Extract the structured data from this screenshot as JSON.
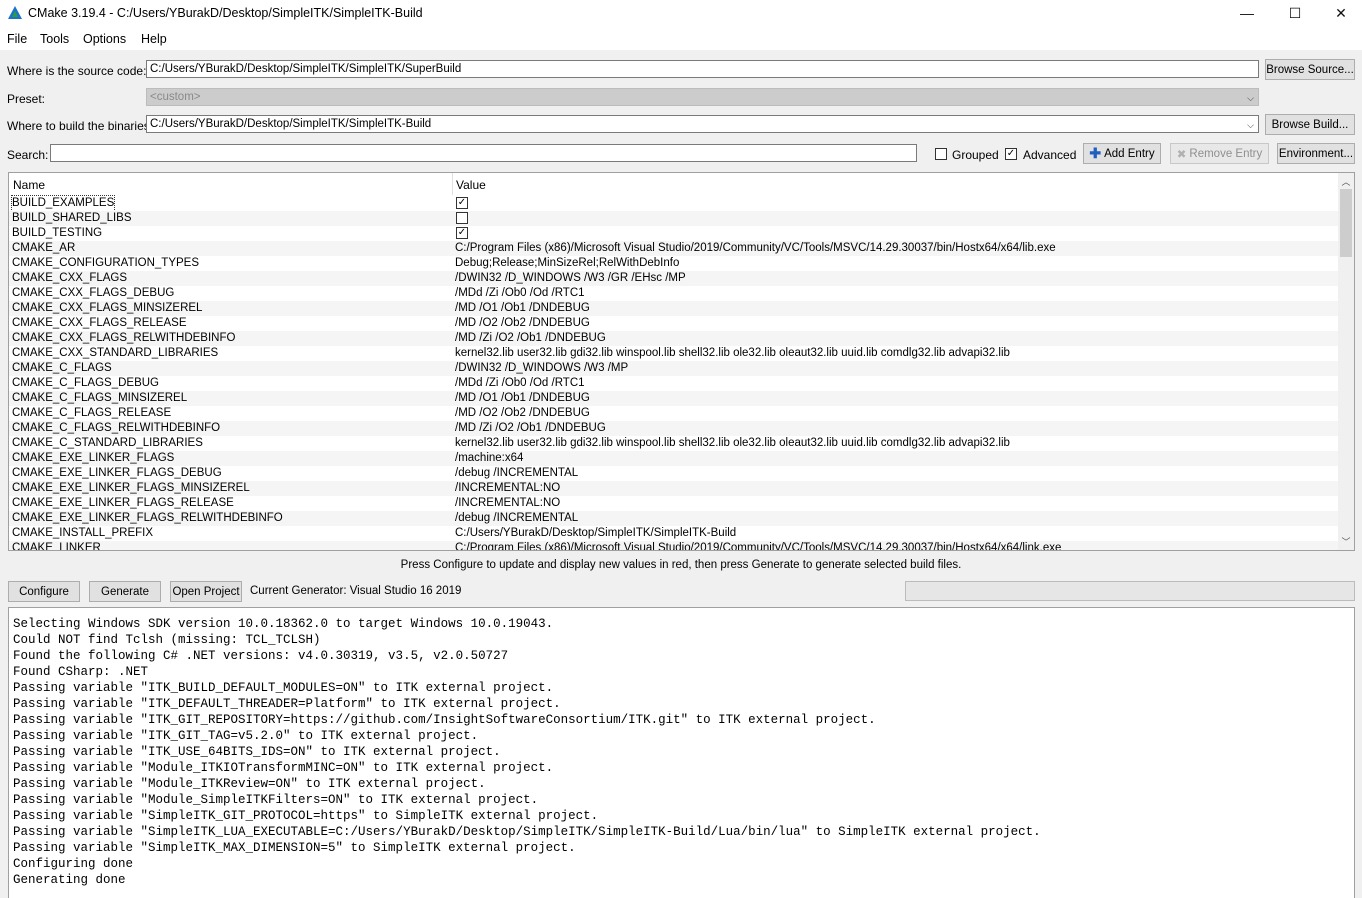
{
  "window": {
    "title": "CMake 3.19.4 - C:/Users/YBurakD/Desktop/SimpleITK/SimpleITK-Build",
    "minimize_glyph": "—",
    "maximize_glyph": "☐",
    "close_glyph": "✕"
  },
  "menu": [
    "File",
    "Tools",
    "Options",
    "Help"
  ],
  "source": {
    "label": "Where is the source code:",
    "value": "C:/Users/YBurakD/Desktop/SimpleITK/SimpleITK/SuperBuild",
    "browse_label": "Browse Source..."
  },
  "preset": {
    "label": "Preset:",
    "value": "<custom>"
  },
  "build": {
    "label": "Where to build the binaries:",
    "value": "C:/Users/YBurakD/Desktop/SimpleITK/SimpleITK-Build",
    "browse_label": "Browse Build..."
  },
  "search": {
    "label": "Search:",
    "value": "",
    "grouped_label": "Grouped",
    "grouped_checked": false,
    "advanced_label": "Advanced",
    "advanced_checked": true,
    "add_entry_label": "Add Entry",
    "remove_entry_label": "Remove Entry",
    "environment_label": "Environment..."
  },
  "table": {
    "columns": [
      "Name",
      "Value"
    ],
    "rows": [
      {
        "name": "BUILD_EXAMPLES",
        "type": "bool",
        "checked": true,
        "value": ""
      },
      {
        "name": "BUILD_SHARED_LIBS",
        "type": "bool",
        "checked": false,
        "value": ""
      },
      {
        "name": "BUILD_TESTING",
        "type": "bool",
        "checked": true,
        "value": ""
      },
      {
        "name": "CMAKE_AR",
        "type": "text",
        "value": "C:/Program Files (x86)/Microsoft Visual Studio/2019/Community/VC/Tools/MSVC/14.29.30037/bin/Hostx64/x64/lib.exe"
      },
      {
        "name": "CMAKE_CONFIGURATION_TYPES",
        "type": "text",
        "value": "Debug;Release;MinSizeRel;RelWithDebInfo"
      },
      {
        "name": "CMAKE_CXX_FLAGS",
        "type": "text",
        "value": "/DWIN32 /D_WINDOWS /W3 /GR /EHsc /MP"
      },
      {
        "name": "CMAKE_CXX_FLAGS_DEBUG",
        "type": "text",
        "value": "/MDd /Zi /Ob0 /Od /RTC1"
      },
      {
        "name": "CMAKE_CXX_FLAGS_MINSIZEREL",
        "type": "text",
        "value": "/MD /O1 /Ob1 /DNDEBUG"
      },
      {
        "name": "CMAKE_CXX_FLAGS_RELEASE",
        "type": "text",
        "value": "/MD /O2 /Ob2 /DNDEBUG"
      },
      {
        "name": "CMAKE_CXX_FLAGS_RELWITHDEBINFO",
        "type": "text",
        "value": "/MD /Zi /O2 /Ob1 /DNDEBUG"
      },
      {
        "name": "CMAKE_CXX_STANDARD_LIBRARIES",
        "type": "text",
        "value": "kernel32.lib user32.lib gdi32.lib winspool.lib shell32.lib ole32.lib oleaut32.lib uuid.lib comdlg32.lib advapi32.lib"
      },
      {
        "name": "CMAKE_C_FLAGS",
        "type": "text",
        "value": "/DWIN32 /D_WINDOWS /W3 /MP"
      },
      {
        "name": "CMAKE_C_FLAGS_DEBUG",
        "type": "text",
        "value": "/MDd /Zi /Ob0 /Od /RTC1"
      },
      {
        "name": "CMAKE_C_FLAGS_MINSIZEREL",
        "type": "text",
        "value": "/MD /O1 /Ob1 /DNDEBUG"
      },
      {
        "name": "CMAKE_C_FLAGS_RELEASE",
        "type": "text",
        "value": "/MD /O2 /Ob2 /DNDEBUG"
      },
      {
        "name": "CMAKE_C_FLAGS_RELWITHDEBINFO",
        "type": "text",
        "value": "/MD /Zi /O2 /Ob1 /DNDEBUG"
      },
      {
        "name": "CMAKE_C_STANDARD_LIBRARIES",
        "type": "text",
        "value": "kernel32.lib user32.lib gdi32.lib winspool.lib shell32.lib ole32.lib oleaut32.lib uuid.lib comdlg32.lib advapi32.lib"
      },
      {
        "name": "CMAKE_EXE_LINKER_FLAGS",
        "type": "text",
        "value": "/machine:x64"
      },
      {
        "name": "CMAKE_EXE_LINKER_FLAGS_DEBUG",
        "type": "text",
        "value": "/debug /INCREMENTAL"
      },
      {
        "name": "CMAKE_EXE_LINKER_FLAGS_MINSIZEREL",
        "type": "text",
        "value": "/INCREMENTAL:NO"
      },
      {
        "name": "CMAKE_EXE_LINKER_FLAGS_RELEASE",
        "type": "text",
        "value": "/INCREMENTAL:NO"
      },
      {
        "name": "CMAKE_EXE_LINKER_FLAGS_RELWITHDEBINFO",
        "type": "text",
        "value": "/debug /INCREMENTAL"
      },
      {
        "name": "CMAKE_INSTALL_PREFIX",
        "type": "text",
        "value": "C:/Users/YBurakD/Desktop/SimpleITK/SimpleITK-Build"
      },
      {
        "name": "CMAKE_LINKER",
        "type": "text",
        "value": "C:/Program Files (x86)/Microsoft Visual Studio/2019/Community/VC/Tools/MSVC/14.29.30037/bin/Hostx64/x64/link.exe"
      }
    ]
  },
  "hint": "Press Configure to update and display new values in red, then press Generate to generate selected build files.",
  "actions": {
    "configure_label": "Configure",
    "generate_label": "Generate",
    "open_project_label": "Open Project",
    "generator_text": "Current Generator: Visual Studio 16 2019"
  },
  "progress": 0,
  "output_lines": [
    "Selecting Windows SDK version 10.0.18362.0 to target Windows 10.0.19043.",
    "Could NOT find Tclsh (missing: TCL_TCLSH)",
    "Found the following C# .NET versions: v4.0.30319, v3.5, v2.0.50727",
    "Found CSharp: .NET",
    "Passing variable \"ITK_BUILD_DEFAULT_MODULES=ON\" to ITK external project.",
    "Passing variable \"ITK_DEFAULT_THREADER=Platform\" to ITK external project.",
    "Passing variable \"ITK_GIT_REPOSITORY=https://github.com/InsightSoftwareConsortium/ITK.git\" to ITK external project.",
    "Passing variable \"ITK_GIT_TAG=v5.2.0\" to ITK external project.",
    "Passing variable \"ITK_USE_64BITS_IDS=ON\" to ITK external project.",
    "Passing variable \"Module_ITKIOTransformMINC=ON\" to ITK external project.",
    "Passing variable \"Module_ITKReview=ON\" to ITK external project.",
    "Passing variable \"Module_SimpleITKFilters=ON\" to ITK external project.",
    "Passing variable \"SimpleITK_GIT_PROTOCOL=https\" to SimpleITK external project.",
    "Passing variable \"SimpleITK_LUA_EXECUTABLE=C:/Users/YBurakD/Desktop/SimpleITK/SimpleITK-Build/Lua/bin/lua\" to SimpleITK external project.",
    "Passing variable \"SimpleITK_MAX_DIMENSION=5\" to SimpleITK external project.",
    "Configuring done",
    "Generating done"
  ]
}
